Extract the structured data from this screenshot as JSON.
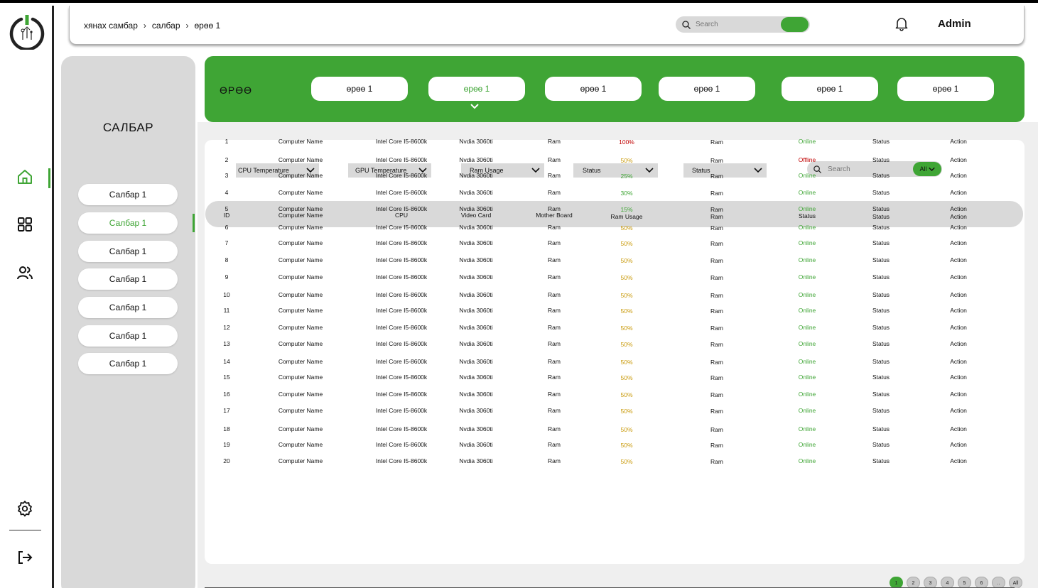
{
  "header": {
    "breadcrumb": [
      "хянах самбар",
      "салбар",
      "өрөө 1"
    ],
    "search_placeholder": "Search",
    "user": "Admin"
  },
  "sidebar": {
    "icons": [
      "home-icon",
      "grid-icon",
      "users-icon",
      "settings-icon",
      "logout-icon"
    ]
  },
  "categories": {
    "title": "САЛБАР",
    "items": [
      "Салбар 1",
      "Салбар 1",
      "Салбар 1",
      "Салбар 1",
      "Салбар 1",
      "Салбар 1",
      "Салбар 1"
    ],
    "active_index": 1
  },
  "rooms": {
    "title": "ӨРӨӨ",
    "tabs": [
      "өрөө 1",
      "өрөө 1",
      "өрөө 1",
      "өрөө 1",
      "өрөө 1",
      "өрөө 1"
    ],
    "active_index": 1
  },
  "filters": [
    "CPU Temperature",
    "GPU Temperature",
    "Ram Usage",
    "Status",
    "Status"
  ],
  "table_search": {
    "placeholder": "Search",
    "filter_label": "All"
  },
  "table": {
    "columns": [
      "ID",
      "Computer Name",
      "CPU",
      "Video Card",
      "Mother Board",
      "Ram Usage",
      "Ram",
      "Status",
      "Status",
      "Action"
    ],
    "rows": [
      [
        "1",
        "Computer Name",
        "Intel Core I5-8600k",
        "Nvdia 3060ti",
        "Ram",
        "100%",
        "Ram",
        "Online",
        "Status",
        "Action"
      ],
      [
        "2",
        "Computer Name",
        "Intel Core I5-8600k",
        "Nvdia 3060ti",
        "Ram",
        "50%",
        "Ram",
        "Offline",
        "Status",
        "Action"
      ],
      [
        "3",
        "Computer Name",
        "Intel Core I5-8600k",
        "Nvdia 3060ti",
        "Ram",
        "25%",
        "Ram",
        "Online",
        "Status",
        "Action"
      ],
      [
        "4",
        "Computer Name",
        "Intel Core I5-8600k",
        "Nvdia 3060ti",
        "Ram",
        "30%",
        "Ram",
        "Online",
        "Status",
        "Action"
      ],
      [
        "5",
        "Computer Name",
        "Intel Core I5-8600k",
        "Nvdia 3060ti",
        "Ram",
        "15%",
        "Ram",
        "Online",
        "Status",
        "Action"
      ],
      [
        "6",
        "Computer Name",
        "Intel Core I5-8600k",
        "Nvdia 3060ti",
        "Ram",
        "50%",
        "Ram",
        "Online",
        "Status",
        "Action"
      ],
      [
        "7",
        "Computer Name",
        "Intel Core I5-8600k",
        "Nvdia 3060ti",
        "Ram",
        "50%",
        "Ram",
        "Online",
        "Status",
        "Action"
      ],
      [
        "8",
        "Computer Name",
        "Intel Core I5-8600k",
        "Nvdia 3060ti",
        "Ram",
        "50%",
        "Ram",
        "Online",
        "Status",
        "Action"
      ],
      [
        "9",
        "Computer Name",
        "Intel Core I5-8600k",
        "Nvdia 3060ti",
        "Ram",
        "50%",
        "Ram",
        "Online",
        "Status",
        "Action"
      ],
      [
        "10",
        "Computer Name",
        "Intel Core I5-8600k",
        "Nvdia 3060ti",
        "Ram",
        "50%",
        "Ram",
        "Online",
        "Status",
        "Action"
      ],
      [
        "11",
        "Computer Name",
        "Intel Core I5-8600k",
        "Nvdia 3060ti",
        "Ram",
        "50%",
        "Ram",
        "Online",
        "Status",
        "Action"
      ],
      [
        "12",
        "Computer Name",
        "Intel Core I5-8600k",
        "Nvdia 3060ti",
        "Ram",
        "50%",
        "Ram",
        "Online",
        "Status",
        "Action"
      ],
      [
        "13",
        "Computer Name",
        "Intel Core I5-8600k",
        "Nvdia 3060ti",
        "Ram",
        "50%",
        "Ram",
        "Online",
        "Status",
        "Action"
      ],
      [
        "14",
        "Computer Name",
        "Intel Core I5-8600k",
        "Nvdia 3060ti",
        "Ram",
        "50%",
        "Ram",
        "Online",
        "Status",
        "Action"
      ],
      [
        "15",
        "Computer Name",
        "Intel Core I5-8600k",
        "Nvdia 3060ti",
        "Ram",
        "50%",
        "Ram",
        "Online",
        "Status",
        "Action"
      ],
      [
        "16",
        "Computer Name",
        "Intel Core I5-8600k",
        "Nvdia 3060ti",
        "Ram",
        "50%",
        "Ram",
        "Online",
        "Status",
        "Action"
      ],
      [
        "17",
        "Computer Name",
        "Intel Core I5-8600k",
        "Nvdia 3060ti",
        "Ram",
        "50%",
        "Ram",
        "Online",
        "Status",
        "Action"
      ],
      [
        "18",
        "Computer Name",
        "Intel Core I5-8600k",
        "Nvdia 3060ti",
        "Ram",
        "50%",
        "Ram",
        "Online",
        "Status",
        "Action"
      ],
      [
        "19",
        "Computer Name",
        "Intel Core I5-8600k",
        "Nvdia 3060ti",
        "Ram",
        "50%",
        "Ram",
        "Online",
        "Status",
        "Action"
      ],
      [
        "20",
        "Computer Name",
        "Intel Core I5-8600k",
        "Nvdia 3060ti",
        "Ram",
        "50%",
        "Ram",
        "Online",
        "Status",
        "Action"
      ]
    ]
  },
  "pagination": [
    "1",
    "2",
    "3",
    "4",
    "5",
    "6",
    "..",
    "All"
  ],
  "pagination_active": 0,
  "colors": {
    "accent": "#3fa535",
    "panel": "#d9d9d9",
    "online": "#3fa535",
    "offline": "#c00000",
    "usage_mid": "#c99a0a",
    "usage_high": "#c00000"
  }
}
